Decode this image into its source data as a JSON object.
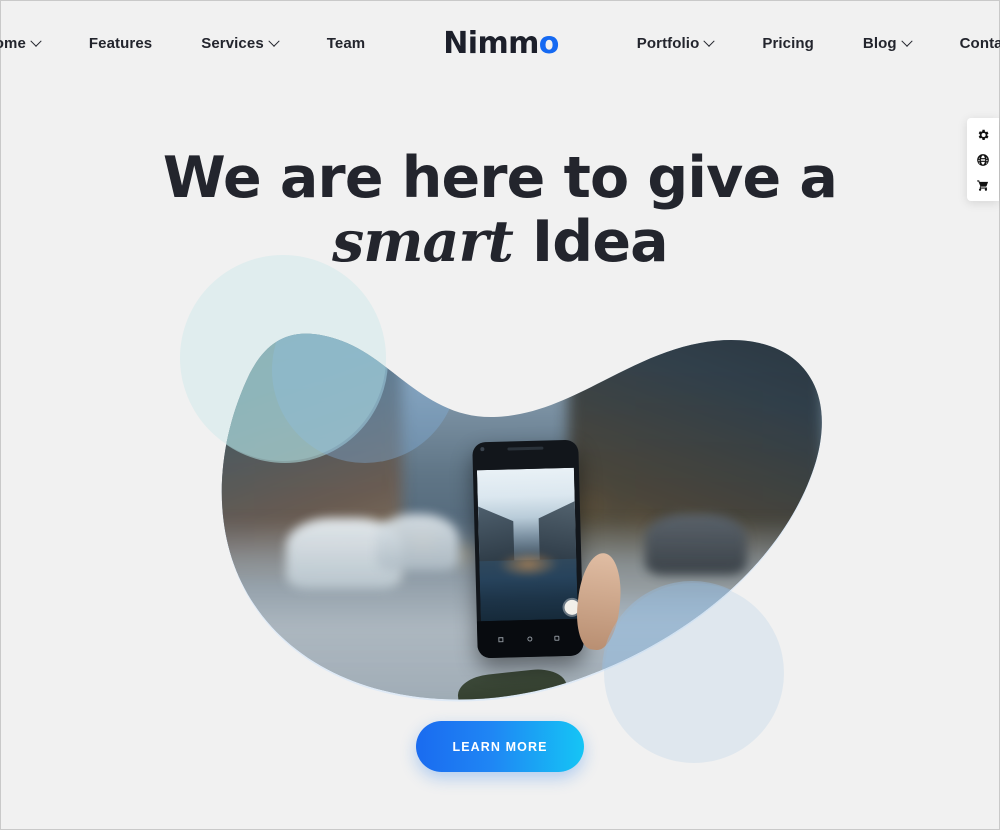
{
  "brand": {
    "logo_text": "Nimm",
    "logo_accent": "o",
    "accent_color": "#1569f2"
  },
  "nav": {
    "left_items": [
      {
        "label": "Home",
        "has_dropdown": true
      },
      {
        "label": "Features",
        "has_dropdown": false
      },
      {
        "label": "Services",
        "has_dropdown": true
      },
      {
        "label": "Team",
        "has_dropdown": false
      }
    ],
    "right_items": [
      {
        "label": "Portfolio",
        "has_dropdown": true
      },
      {
        "label": "Pricing",
        "has_dropdown": false
      },
      {
        "label": "Blog",
        "has_dropdown": true
      },
      {
        "label": "Contact",
        "has_dropdown": false
      }
    ]
  },
  "hero": {
    "line1": "We are here to give a",
    "line2_italic": "smart",
    "line2_rest": " Idea",
    "cta_label": "LEARN MORE",
    "cta_gradient_from": "#1a6bf0",
    "cta_gradient_to": "#15c5f5",
    "image_alt": "Hand holding a smartphone photographing a blurred city street at dusk"
  },
  "side_panel": {
    "items": [
      {
        "icon": "gear-icon",
        "name": "settings"
      },
      {
        "icon": "globe-icon",
        "name": "language"
      },
      {
        "icon": "cart-icon",
        "name": "cart"
      }
    ]
  },
  "page": {
    "background_color": "#f1f1f1",
    "text_color": "#23252d"
  }
}
